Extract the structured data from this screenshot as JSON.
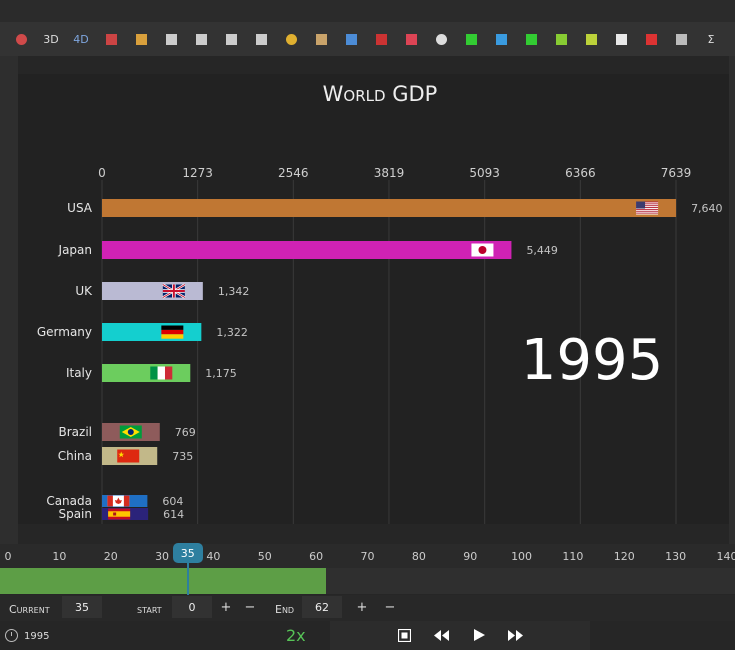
{
  "toolbar": {
    "items": [
      {
        "name": "sphere-icon",
        "color": "#d04a4a"
      },
      {
        "name": "3d-button",
        "text": "3D"
      },
      {
        "name": "4d-button",
        "text": "4D",
        "color": "#7fa7e0"
      },
      {
        "name": "chart-grid-icon",
        "color": "#c44"
      },
      {
        "name": "bar-chart-icon",
        "color": "#d9a03c"
      },
      {
        "name": "line-chart-icon",
        "color": "#ccc"
      },
      {
        "name": "list-bars-icon",
        "color": "#ccc"
      },
      {
        "name": "histogram-icon",
        "color": "#ccc"
      },
      {
        "name": "pentagon-icon",
        "color": "#ccc"
      },
      {
        "name": "arc-icon",
        "color": "#e0b030"
      },
      {
        "name": "cube-icon",
        "color": "#c9a36a"
      },
      {
        "name": "column-chart-icon",
        "color": "#4c8cd6"
      },
      {
        "name": "red-green-bars-icon",
        "color": "#c33"
      },
      {
        "name": "pyramid-icon",
        "color": "#d45"
      },
      {
        "name": "donut-icon",
        "color": "#ddd"
      },
      {
        "name": "scale-icon",
        "color": "#3c3"
      },
      {
        "name": "heatmap-icon",
        "color": "#3a9be0"
      },
      {
        "name": "up-down-arrows-icon",
        "color": "#3c3"
      },
      {
        "name": "africa-map-icon",
        "color": "#8c3"
      },
      {
        "name": "stacked-lines-icon",
        "color": "#bcd23a"
      },
      {
        "name": "document-icon",
        "color": "#e8e8e8"
      },
      {
        "name": "red-square-icon",
        "color": "#d33"
      },
      {
        "name": "chevrons-icon",
        "color": "#bbb"
      },
      {
        "name": "sigma-button",
        "text": "Σ"
      }
    ]
  },
  "chart_data": {
    "type": "bar",
    "title": "World GDP",
    "year": "1995",
    "ticks": [
      0,
      1273,
      2546,
      3819,
      5093,
      6366,
      7639
    ],
    "xlim": [
      0,
      7639
    ],
    "bars": [
      {
        "category": "USA",
        "value": 7640,
        "label": "7,640",
        "color": "#c07733",
        "flag": "usa-flag"
      },
      {
        "category": "Japan",
        "value": 5449,
        "label": "5,449",
        "color": "#d022b4",
        "flag": "japan-flag"
      },
      {
        "category": "UK",
        "value": 1342,
        "label": "1,342",
        "color": "#babad3",
        "flag": "uk-flag"
      },
      {
        "category": "Germany",
        "value": 1322,
        "label": "1,322",
        "color": "#14cfcf",
        "flag": "germany-flag"
      },
      {
        "category": "Italy",
        "value": 1175,
        "label": "1,175",
        "color": "#6ccd5e",
        "flag": "italy-flag"
      },
      {
        "category": "Brazil",
        "value": 769,
        "label": "769",
        "color": "#8e5b5b",
        "flag": "brazil-flag"
      },
      {
        "category": "China",
        "value": 735,
        "label": "735",
        "color": "#c2b889",
        "flag": "china-flag"
      },
      {
        "category": "Canada",
        "value": 604,
        "label": "604",
        "color": "#1f6fc4",
        "flag": "canada-flag"
      },
      {
        "category": "Spain",
        "value": 614,
        "label": "614",
        "color": "#2b237a",
        "flag": "spain-flag"
      }
    ]
  },
  "timeline": {
    "ticks": [
      "0",
      "10",
      "20",
      "30",
      "40",
      "50",
      "60",
      "70",
      "80",
      "90",
      "100",
      "110",
      "120",
      "130",
      "140"
    ],
    "max": 140,
    "current": 35,
    "end": 62
  },
  "controls": {
    "current_label": "Current",
    "current_value": "35",
    "start_label": "start",
    "start_value": "0",
    "end_label": "End",
    "end_value": "62",
    "plus": "+",
    "minus": "−"
  },
  "footer": {
    "year": "1995",
    "speed": "2x"
  }
}
